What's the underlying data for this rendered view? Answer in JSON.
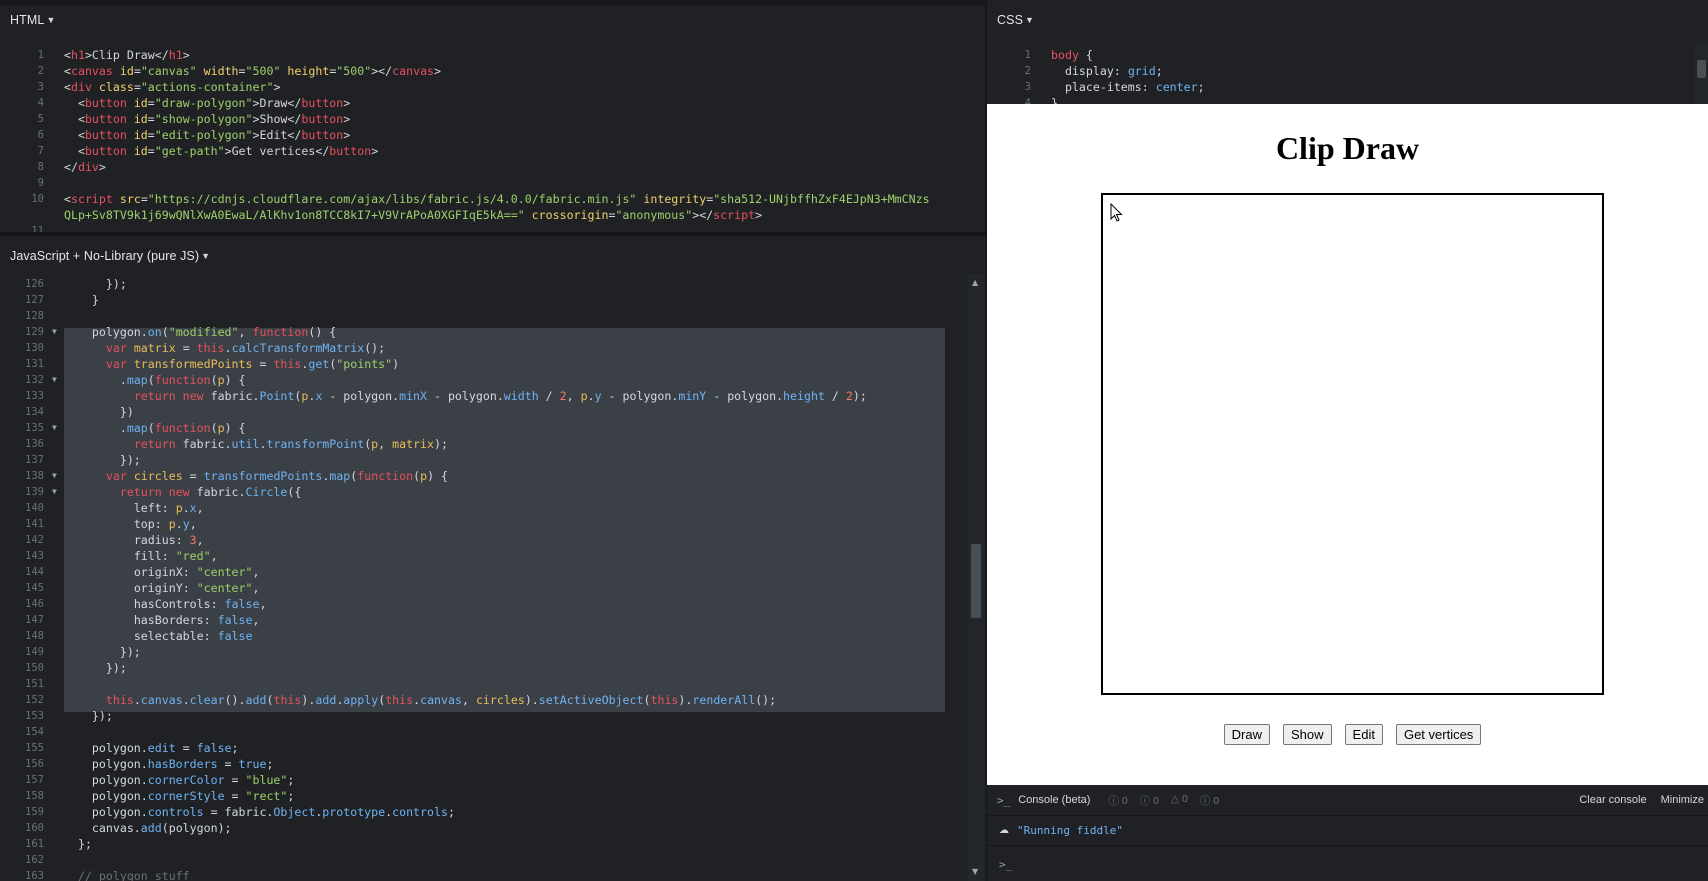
{
  "html_pane": {
    "title": "HTML",
    "lines": [
      {
        "n": "1",
        "html": "<span class='pr'>&lt;</span><span class='tg'>h1</span><span class='pr'>&gt;Clip Draw&lt;/</span><span class='tg'>h1</span><span class='pr'>&gt;</span>"
      },
      {
        "n": "2",
        "html": "<span class='pr'>&lt;</span><span class='tg'>canvas</span> <span class='at'>id</span>=<span class='st'>\"canvas\"</span> <span class='at'>width</span>=<span class='st'>\"500\"</span> <span class='at'>height</span>=<span class='st'>\"500\"</span><span class='pr'>&gt;&lt;/</span><span class='tg'>canvas</span><span class='pr'>&gt;</span>"
      },
      {
        "n": "3",
        "html": "<span class='pr'>&lt;</span><span class='tg'>div</span> <span class='at'>class</span>=<span class='st'>\"actions-container\"</span><span class='pr'>&gt;</span>"
      },
      {
        "n": "4",
        "html": "  <span class='pr'>&lt;</span><span class='tg'>button</span> <span class='at'>id</span>=<span class='st'>\"draw-polygon\"</span><span class='pr'>&gt;Draw&lt;/</span><span class='tg'>button</span><span class='pr'>&gt;</span>"
      },
      {
        "n": "5",
        "html": "  <span class='pr'>&lt;</span><span class='tg'>button</span> <span class='at'>id</span>=<span class='st'>\"show-polygon\"</span><span class='pr'>&gt;Show&lt;/</span><span class='tg'>button</span><span class='pr'>&gt;</span>"
      },
      {
        "n": "6",
        "html": "  <span class='pr'>&lt;</span><span class='tg'>button</span> <span class='at'>id</span>=<span class='st'>\"edit-polygon\"</span><span class='pr'>&gt;Edit&lt;/</span><span class='tg'>button</span><span class='pr'>&gt;</span>"
      },
      {
        "n": "7",
        "html": "  <span class='pr'>&lt;</span><span class='tg'>button</span> <span class='at'>id</span>=<span class='st'>\"get-path\"</span><span class='pr'>&gt;Get vertices&lt;/</span><span class='tg'>button</span><span class='pr'>&gt;</span>"
      },
      {
        "n": "8",
        "html": "<span class='pr'>&lt;/</span><span class='tg'>div</span><span class='pr'>&gt;</span>"
      },
      {
        "n": "9",
        "html": ""
      },
      {
        "n": "10",
        "html": "<span class='pr'>&lt;</span><span class='tg'>script</span> <span class='at'>src</span>=<span class='st'>\"https://cdnjs.cloudflare.com/ajax/libs/fabric.js/4.0.0/fabric.min.js\"</span> <span class='at'>integrity</span>=<span class='st'>\"sha512-UNjbffhZxF4EJpN3+MmCNzs</span>"
      },
      {
        "n": "",
        "html": "<span class='st'>QLp+Sv8TV9k1j69wQNlXwA0EwaL/AlKhv1on8TCC8kI7+V9VrAPoA0XGFIqE5kA==\"</span> <span class='at'>crossorigin</span>=<span class='st'>\"anonymous\"</span><span class='pr'>&gt;&lt;/</span><span class='tg'>script</span><span class='pr'>&gt;</span>"
      },
      {
        "n": "11",
        "html": ""
      }
    ]
  },
  "css_pane": {
    "title": "CSS",
    "lines": [
      {
        "n": "1",
        "html": "<span class='tg'>body</span> <span class='pr'>{</span>"
      },
      {
        "n": "2",
        "html": "  <span class='pr'>display</span>: <span class='sp'>grid</span>;"
      },
      {
        "n": "3",
        "html": "  <span class='pr'>place-items</span>: <span class='sp'>center</span>;"
      },
      {
        "n": "4",
        "html": "<span class='pr'>}</span>"
      }
    ]
  },
  "js_pane": {
    "title": "JavaScript + No-Library (pure JS)",
    "lines": [
      {
        "n": "126",
        "html": "      });"
      },
      {
        "n": "127",
        "html": "    }"
      },
      {
        "n": "128",
        "html": ""
      },
      {
        "n": "129",
        "fold": true,
        "html": "    polygon.<span class='fn'>on</span>(<span class='st'>\"modified\"</span>, <span class='kw'>function</span>() {"
      },
      {
        "n": "130",
        "html": "      <span class='kw'>var</span> <span class='vr'>matrix</span> = <span class='th'>this</span>.<span class='fn'>calcTransformMatrix</span>();"
      },
      {
        "n": "131",
        "html": "      <span class='kw'>var</span> <span class='vr'>transformedPoints</span> = <span class='th'>this</span>.<span class='fn'>get</span>(<span class='st'>\"points\"</span>)"
      },
      {
        "n": "132",
        "fold": true,
        "html": "        .<span class='fn'>map</span>(<span class='kw'>function</span>(<span class='vr'>p</span>) {"
      },
      {
        "n": "133",
        "html": "          <span class='kw'>return new</span> fabric.<span class='fn'>Point</span>(<span class='vr'>p</span>.<span class='pv'>x</span> - polygon.<span class='pv'>minX</span> - polygon.<span class='pv'>width</span> / <span class='nm'>2</span>, <span class='vr'>p</span>.<span class='pv'>y</span> - polygon.<span class='pv'>minY</span> - polygon.<span class='pv'>height</span> / <span class='nm'>2</span>);"
      },
      {
        "n": "134",
        "html": "        })"
      },
      {
        "n": "135",
        "fold": true,
        "html": "        .<span class='fn'>map</span>(<span class='kw'>function</span>(<span class='vr'>p</span>) {"
      },
      {
        "n": "136",
        "html": "          <span class='kw'>return</span> fabric.<span class='pv'>util</span>.<span class='fn'>transformPoint</span>(<span class='vr'>p</span>, <span class='vr'>matrix</span>);"
      },
      {
        "n": "137",
        "html": "        });"
      },
      {
        "n": "138",
        "fold": true,
        "html": "      <span class='kw'>var</span> <span class='vr'>circles</span> = <span class='fn'>transformedPoints</span>.<span class='fn'>map</span>(<span class='kw'>function</span>(<span class='vr'>p</span>) {"
      },
      {
        "n": "139",
        "fold": true,
        "html": "        <span class='kw'>return new</span> fabric.<span class='fn'>Circle</span>({"
      },
      {
        "n": "140",
        "html": "          <span class='ob'>left</span>: <span class='vr'>p</span>.<span class='pv'>x</span>,"
      },
      {
        "n": "141",
        "html": "          <span class='ob'>top</span>: <span class='vr'>p</span>.<span class='pv'>y</span>,"
      },
      {
        "n": "142",
        "html": "          <span class='ob'>radius</span>: <span class='nm'>3</span>,"
      },
      {
        "n": "143",
        "html": "          <span class='ob'>fill</span>: <span class='st'>\"red\"</span>,"
      },
      {
        "n": "144",
        "html": "          <span class='ob'>originX</span>: <span class='st'>\"center\"</span>,"
      },
      {
        "n": "145",
        "html": "          <span class='ob'>originY</span>: <span class='st'>\"center\"</span>,"
      },
      {
        "n": "146",
        "html": "          <span class='ob'>hasControls</span>: <span class='bo'>false</span>,"
      },
      {
        "n": "147",
        "html": "          <span class='ob'>hasBorders</span>: <span class='bo'>false</span>,"
      },
      {
        "n": "148",
        "html": "          <span class='ob'>selectable</span>: <span class='bo'>false</span>"
      },
      {
        "n": "149",
        "html": "        });"
      },
      {
        "n": "150",
        "html": "      });"
      },
      {
        "n": "151",
        "html": ""
      },
      {
        "n": "152",
        "html": "      <span class='th'>this</span>.<span class='pv'>canvas</span>.<span class='fn'>clear</span>().<span class='fn'>add</span>(<span class='th'>this</span>).<span class='pv'>add</span>.<span class='fn'>apply</span>(<span class='th'>this</span>.<span class='pv'>canvas</span>, <span class='vr'>circles</span>).<span class='fn'>setActiveObject</span>(<span class='th'>this</span>).<span class='fn'>renderAll</span>();"
      },
      {
        "n": "153",
        "html": "    });"
      },
      {
        "n": "154",
        "html": ""
      },
      {
        "n": "155",
        "html": "    polygon.<span class='pv'>edit</span> = <span class='bo'>false</span>;"
      },
      {
        "n": "156",
        "html": "    polygon.<span class='pv'>hasBorders</span> = <span class='bo'>true</span>;"
      },
      {
        "n": "157",
        "html": "    polygon.<span class='pv'>cornerColor</span> = <span class='st'>\"blue\"</span>;"
      },
      {
        "n": "158",
        "html": "    polygon.<span class='pv'>cornerStyle</span> = <span class='st'>\"rect\"</span>;"
      },
      {
        "n": "159",
        "html": "    polygon.<span class='pv'>controls</span> = fabric.<span class='pv'>Object</span>.<span class='pv'>prototype</span>.<span class='pv'>controls</span>;"
      },
      {
        "n": "160",
        "html": "    canvas.<span class='fn'>add</span>(polygon);"
      },
      {
        "n": "161",
        "html": "  };"
      },
      {
        "n": "162",
        "html": ""
      },
      {
        "n": "163",
        "html": "  <span class='cm'>// polygon stuff</span>"
      }
    ]
  },
  "result": {
    "heading": "Clip Draw",
    "buttons": [
      "Draw",
      "Show",
      "Edit",
      "Get vertices"
    ]
  },
  "console": {
    "title": "Console (beta)",
    "counts": [
      "0",
      "0",
      "0",
      "0"
    ],
    "clear_label": "Clear console",
    "minimize_label": "Minimize",
    "log_message": "\"Running fiddle\"",
    "prompt": ">_"
  },
  "colors": {
    "editor_bg": "#1f2125",
    "selection": "#3b3f46",
    "keyword": "#e5525d",
    "string": "#9ed16b"
  }
}
